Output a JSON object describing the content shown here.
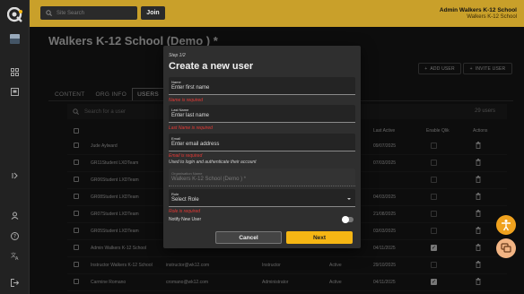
{
  "header": {
    "search_placeholder": "Site Search",
    "join_label": "Join",
    "admin_name": "Admin Walkers K-12 School",
    "admin_org": "Walkers K-12 School"
  },
  "page": {
    "title": "Walkers K-12 School (Demo ) *",
    "add_user_label": "ADD USER",
    "invite_user_label": "INVITE USER",
    "tabs": [
      {
        "label": "CONTENT",
        "active": false
      },
      {
        "label": "ORG INFO",
        "active": false
      },
      {
        "label": "USERS",
        "active": true
      }
    ],
    "search_placeholder": "Search for a user",
    "user_count": "29 users",
    "columns": {
      "last_active": "Last Active",
      "enable_qlik": "Enable Qlik",
      "actions": "Actions"
    },
    "rows": [
      {
        "name": "Jude Aylward",
        "email": "",
        "role": "",
        "status": "",
        "last_active": "09/07/2025",
        "qlik": false
      },
      {
        "name": "GR11Student LXDTeam",
        "email": "",
        "role": "",
        "status": "",
        "last_active": "07/03/2025",
        "qlik": false
      },
      {
        "name": "GR06Student LXDTeam",
        "email": "",
        "role": "",
        "status": "",
        "last_active": "",
        "qlik": false
      },
      {
        "name": "GR08Student LXDTeam",
        "email": "",
        "role": "",
        "status": "",
        "last_active": "04/03/2025",
        "qlik": false
      },
      {
        "name": "GR07Student LXDTeam",
        "email": "",
        "role": "",
        "status": "",
        "last_active": "21/08/2025",
        "qlik": false
      },
      {
        "name": "GR05Student LXDTeam",
        "email": "",
        "role": "",
        "status": "",
        "last_active": "03/03/2025",
        "qlik": false
      },
      {
        "name": "Admin Walkers K-12 School",
        "email": "",
        "role": "",
        "status": "",
        "last_active": "04/11/2025",
        "qlik": true
      },
      {
        "name": "Instructor Walkers K-12 School",
        "email": "instructor@wk12.com",
        "role": "Instructor",
        "status": "Active",
        "last_active": "29/10/2025",
        "qlik": false
      },
      {
        "name": "Carmine Romano",
        "email": "cromano@wk12.com",
        "role": "Administrator",
        "status": "Active",
        "last_active": "04/11/2025",
        "qlik": true
      }
    ]
  },
  "modal": {
    "step": "Step 1/2",
    "title": "Create a new user",
    "first_name_label": "Name",
    "first_name_value": "Enter first name",
    "first_name_error": "Name is required",
    "last_name_label": "Last Name",
    "last_name_value": "Enter last name",
    "last_name_error": "Last Name is required",
    "email_label": "Email",
    "email_value": "Enter email address",
    "email_error": "Email is required",
    "email_help": "Used to login and authenticate their account",
    "org_label": "Organisation Name",
    "org_value": "Walkers K-12 School (Demo ) *",
    "role_label": "Role",
    "role_value": "Select Role",
    "role_error": "Role is required",
    "notify_label": "Notify New User",
    "cancel_label": "Cancel",
    "next_label": "Next"
  },
  "colors": {
    "accent": "#f5b614",
    "header": "#c9a02a",
    "error": "#e53935"
  }
}
